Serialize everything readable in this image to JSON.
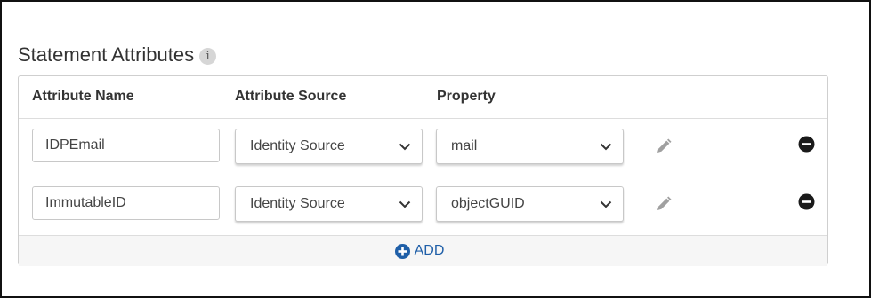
{
  "section": {
    "title": "Statement Attributes",
    "info_glyph": "i"
  },
  "table": {
    "headers": [
      "Attribute Name",
      "Attribute Source",
      "Property"
    ],
    "rows": [
      {
        "name": "IDPEmail",
        "source": "Identity Source",
        "property": "mail"
      },
      {
        "name": "ImmutableID",
        "source": "Identity Source",
        "property": "objectGUID"
      }
    ]
  },
  "footer": {
    "add_label": "ADD"
  },
  "icons": {
    "info": "info-icon",
    "dropdown": "chevron-down-icon",
    "edit": "pencil-icon",
    "remove": "minus-circle-icon",
    "add": "plus-circle-icon"
  },
  "colors": {
    "accent": "#1f5fa8",
    "remove_icon": "#1a1a1a",
    "pencil_icon": "#9a9a9a"
  }
}
